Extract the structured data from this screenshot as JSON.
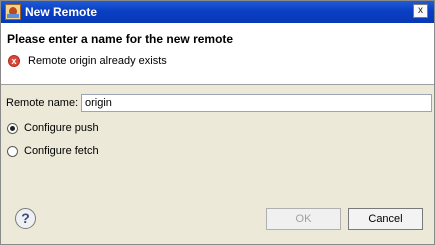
{
  "window": {
    "title": "New Remote",
    "close_glyph": "x",
    "app_icon": "egit-icon"
  },
  "banner": {
    "heading": "Please enter a name for the new remote",
    "error_icon": "error-icon",
    "error_glyph": "x",
    "error_text": "Remote origin already exists"
  },
  "form": {
    "name_label": "Remote name:",
    "name_value": "origin"
  },
  "options": {
    "push_label": "Configure push",
    "push_checked": true,
    "fetch_label": "Configure fetch",
    "fetch_checked": false
  },
  "footer": {
    "help_glyph": "?",
    "ok_label": "OK",
    "cancel_label": "Cancel"
  }
}
